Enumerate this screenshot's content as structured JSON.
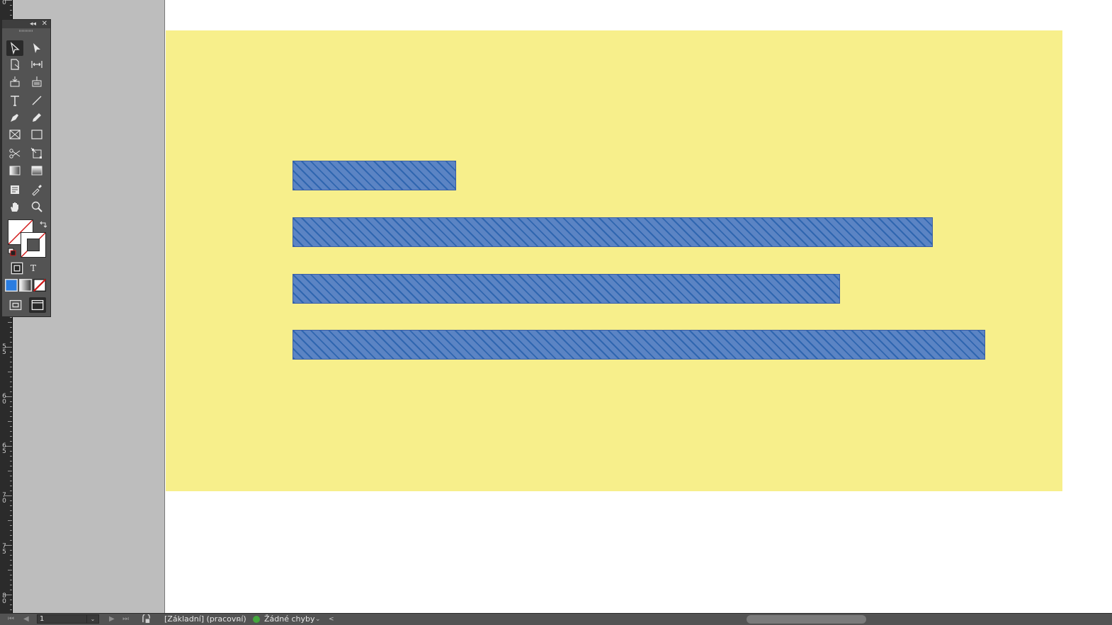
{
  "vertical_ruler": {
    "labels": [
      "0",
      "5",
      "5",
      "6",
      "0",
      "6",
      "5",
      "7",
      "0",
      "7",
      "5",
      "8",
      "0"
    ]
  },
  "tools_panel": {
    "collapse_glyph": "◂◂",
    "close_glyph": "✕",
    "tools": [
      {
        "name": "selection-tool-icon"
      },
      {
        "name": "direct-selection-tool-icon"
      },
      {
        "name": "page-tool-icon"
      },
      {
        "name": "gap-tool-icon"
      },
      {
        "name": "content-collector-icon"
      },
      {
        "name": "content-placer-icon"
      },
      {
        "name": "type-tool-icon"
      },
      {
        "name": "line-tool-icon"
      },
      {
        "name": "pen-tool-icon"
      },
      {
        "name": "pencil-tool-icon"
      },
      {
        "name": "rectangle-frame-tool-icon"
      },
      {
        "name": "rectangle-tool-icon"
      },
      {
        "name": "scissors-tool-icon"
      },
      {
        "name": "free-transform-tool-icon"
      },
      {
        "name": "gradient-swatch-tool-icon"
      },
      {
        "name": "gradient-feather-tool-icon"
      },
      {
        "name": "note-tool-icon"
      },
      {
        "name": "eyedropper-tool-icon"
      },
      {
        "name": "hand-tool-icon"
      },
      {
        "name": "zoom-tool-icon"
      }
    ],
    "format_text_label": "T"
  },
  "document": {
    "page_color": "#f7ef8b",
    "bar_color": "#5b84c4",
    "bars": [
      {
        "length_fraction": 0.2359
      },
      {
        "length_fraction": 0.9243
      },
      {
        "length_fraction": 0.7902
      },
      {
        "length_fraction": 1.0
      }
    ]
  },
  "status_bar": {
    "first_page_glyph": "⏮",
    "prev_page_glyph": "◀",
    "page_number": "1",
    "next_page_glyph": "▶",
    "last_page_glyph": "⏭",
    "profile": "[Základní] (pracovní)",
    "preflight": "Žádné chyby",
    "dropdown_glyph": "⌄",
    "scroll_left_glyph": "<"
  }
}
